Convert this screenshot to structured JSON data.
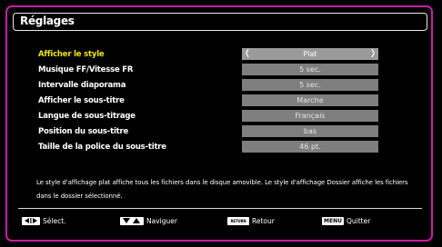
{
  "title": "Réglages",
  "settings": [
    {
      "label": "Afficher le style",
      "value": "Plat",
      "selected": true
    },
    {
      "label": "Musique FF/Vitesse FR",
      "value": "5 sec."
    },
    {
      "label": "Intervalle diaporama",
      "value": "5 sec."
    },
    {
      "label": "Afficher le sous-titre",
      "value": "Marche"
    },
    {
      "label": "Langue de sous-titrage",
      "value": "Français"
    },
    {
      "label": "Position du sous-titre",
      "value": "bas"
    },
    {
      "label": "Taille de la police du sous-titre",
      "value": "46 pt."
    }
  ],
  "description": "Le style d'affichage plat affiche tous les fichiers dans le disque amovible. Le style d'affichage Dossier affiche les fichiers dans le dossier sélectionné.",
  "footer": {
    "select": {
      "label": "Sélect.",
      "icon": "left-right-arrows-icon"
    },
    "navigate": {
      "label": "Naviguer",
      "icon": "up-down-arrows-icon"
    },
    "back": {
      "label": "Retour",
      "key": "RETURN"
    },
    "quit": {
      "label": "Quitter",
      "key": "MENU"
    }
  },
  "colors": {
    "frame": "#c81ea8",
    "selected_label": "#f2e600",
    "value_bg": "#7e7e7e"
  }
}
